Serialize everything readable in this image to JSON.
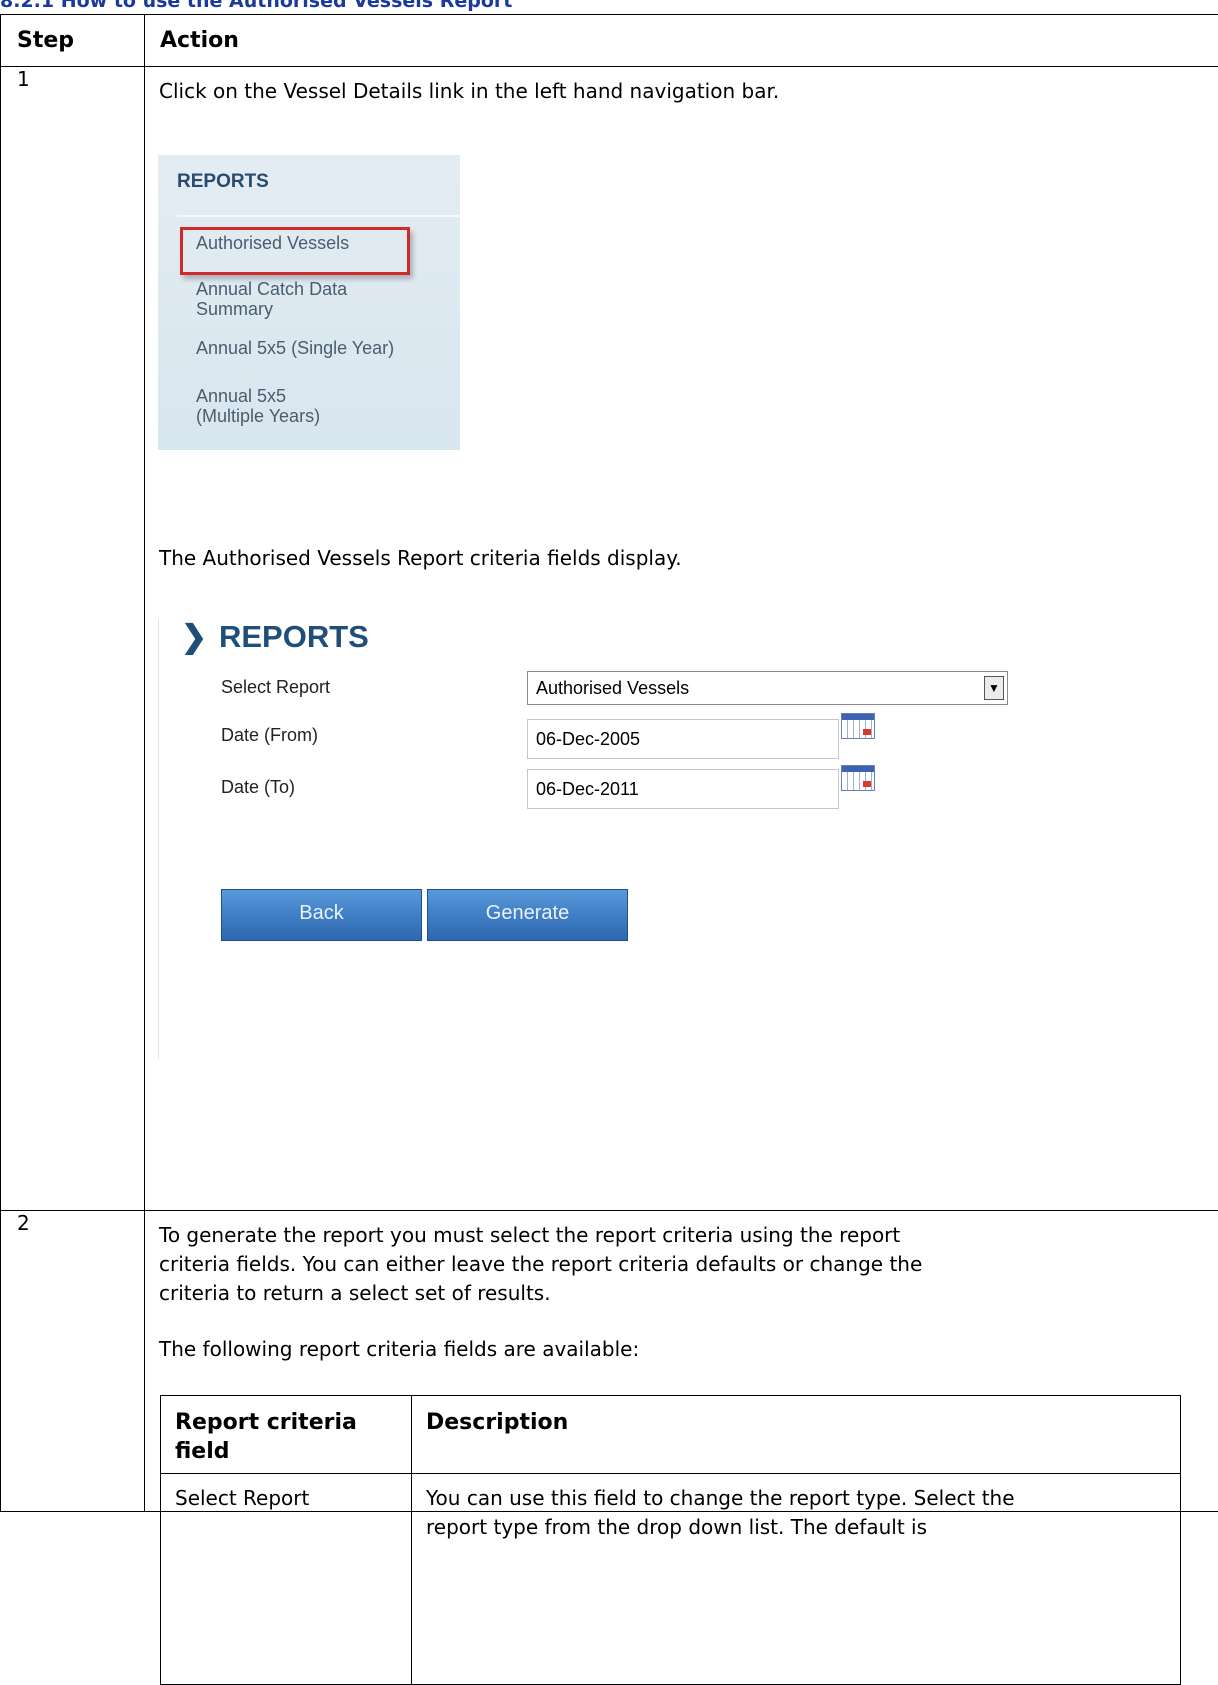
{
  "section": {
    "heading": "8.2.1 How to use the Authorised Vessels Report"
  },
  "step_table": {
    "headers": [
      "Step",
      "Action"
    ],
    "rows": [
      {
        "step": "1",
        "intro": "Click on the Vessel Details link in the left hand navigation bar.",
        "nav_panel": {
          "title": "REPORTS",
          "items": [
            "Authorised Vessels",
            "Annual Catch Data Summary",
            "Annual 5x5 (Single Year)",
            "Annual 5x5 (Multiple Years)"
          ],
          "item_lines": [
            [
              "Authorised Vessels"
            ],
            [
              "Annual Catch Data",
              "Summary"
            ],
            [
              "Annual 5x5 (Single Year)"
            ],
            [
              "Annual 5x5",
              "(Multiple Years)"
            ]
          ]
        },
        "display_text": "The Authorised Vessels Report criteria fields display.",
        "reports_form": {
          "title": "REPORTS",
          "select_label": "Select Report",
          "select_value": "Authorised Vessels",
          "date_from_label": "Date (From)",
          "date_from_value": "06-Dec-2005",
          "date_to_label": "Date (To)",
          "date_to_value": "06-Dec-2011",
          "back_label": "Back",
          "generate_label": "Generate"
        }
      },
      {
        "step": "2",
        "paragraph_lines": [
          "To generate the report you must select the report criteria using the report",
          "criteria fields.  You can either leave the report criteria defaults or change the",
          "criteria to return a select set of results."
        ],
        "available_text": "The following report criteria fields are available:",
        "criteria_table": {
          "headers": [
            "Report criteria field",
            "Description"
          ],
          "header_lines": [
            "Report criteria",
            "field"
          ],
          "rows": [
            {
              "field": "Select Report",
              "description_lines": [
                "You can use this field to change the report type. Select the",
                "report type from the drop down list. The default is"
              ]
            }
          ]
        }
      }
    ]
  },
  "colors": {
    "heading": "#1a3a9c",
    "highlight_border": "#cf2a2a",
    "form_title": "#1f4e79",
    "button": "#3e7cc4"
  }
}
